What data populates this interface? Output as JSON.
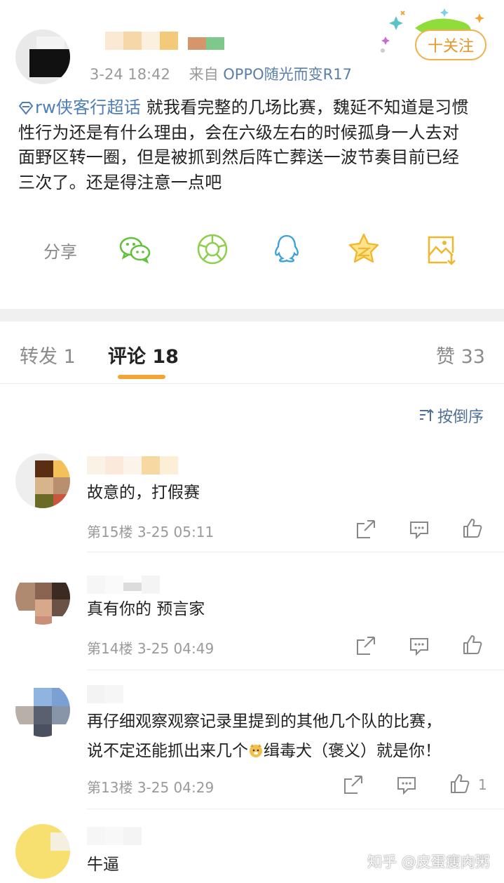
{
  "post": {
    "meta_time": "3-24 18:42",
    "meta_from": "来自",
    "meta_device": "OPPO随光而变R17",
    "follow_label": "十关注",
    "topic": "rw侠客行超话",
    "lines": [
      " 就我看完整的几场比赛，魏延不知道是习惯",
      "性行为还是有什么理由，会在六级左右的时候孤身一人去对",
      "面野区转一圈，但是被抓到然后阵亡葬送一波节奏目前已经",
      "三次了。还是得注意一点吧"
    ]
  },
  "share": {
    "label": "分享",
    "icons": [
      "wechat-icon",
      "moments-icon",
      "qq-icon",
      "qzone-icon",
      "save-image-icon"
    ]
  },
  "tabs": {
    "repost": "转发 1",
    "comments": "评论 18",
    "likes": "赞 33"
  },
  "sort_label": "按倒序",
  "comments": [
    {
      "text": "故意的，打假赛",
      "floor": "第15楼",
      "time": "3-25 05:11",
      "likes": ""
    },
    {
      "text": "真有你的 预言家",
      "floor": "第14楼",
      "time": "3-25 04:49",
      "likes": ""
    },
    {
      "text_line1": "再仔细观察观察记录里提到的其他几个队的比赛，",
      "text_line2a": "说不定还能抓出来几个",
      "text_line2b": "缉毒犬（褒义）就是你！",
      "floor": "第13楼",
      "time": "3-25 04:29",
      "likes": "1"
    },
    {
      "text": "牛逼"
    }
  ],
  "watermark": "知乎 @皮蛋瘦肉粥",
  "colors": {
    "accent": "#f2a535",
    "link": "#4f7db5",
    "muted": "#9a9a9a"
  }
}
